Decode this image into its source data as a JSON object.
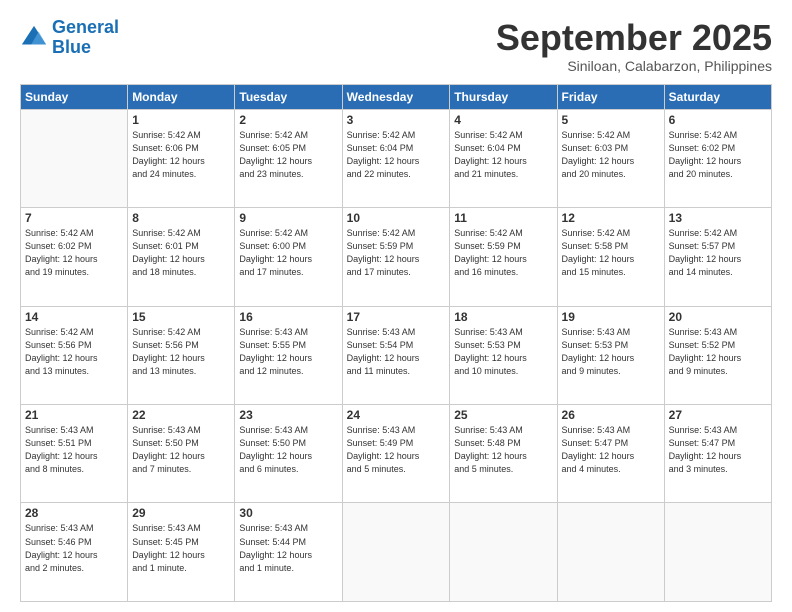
{
  "logo": {
    "text_general": "General",
    "text_blue": "Blue"
  },
  "header": {
    "month": "September 2025",
    "location": "Siniloan, Calabarzon, Philippines"
  },
  "weekdays": [
    "Sunday",
    "Monday",
    "Tuesday",
    "Wednesday",
    "Thursday",
    "Friday",
    "Saturday"
  ],
  "weeks": [
    [
      {
        "day": "",
        "info": ""
      },
      {
        "day": "1",
        "info": "Sunrise: 5:42 AM\nSunset: 6:06 PM\nDaylight: 12 hours\nand 24 minutes."
      },
      {
        "day": "2",
        "info": "Sunrise: 5:42 AM\nSunset: 6:05 PM\nDaylight: 12 hours\nand 23 minutes."
      },
      {
        "day": "3",
        "info": "Sunrise: 5:42 AM\nSunset: 6:04 PM\nDaylight: 12 hours\nand 22 minutes."
      },
      {
        "day": "4",
        "info": "Sunrise: 5:42 AM\nSunset: 6:04 PM\nDaylight: 12 hours\nand 21 minutes."
      },
      {
        "day": "5",
        "info": "Sunrise: 5:42 AM\nSunset: 6:03 PM\nDaylight: 12 hours\nand 20 minutes."
      },
      {
        "day": "6",
        "info": "Sunrise: 5:42 AM\nSunset: 6:02 PM\nDaylight: 12 hours\nand 20 minutes."
      }
    ],
    [
      {
        "day": "7",
        "info": "Sunrise: 5:42 AM\nSunset: 6:02 PM\nDaylight: 12 hours\nand 19 minutes."
      },
      {
        "day": "8",
        "info": "Sunrise: 5:42 AM\nSunset: 6:01 PM\nDaylight: 12 hours\nand 18 minutes."
      },
      {
        "day": "9",
        "info": "Sunrise: 5:42 AM\nSunset: 6:00 PM\nDaylight: 12 hours\nand 17 minutes."
      },
      {
        "day": "10",
        "info": "Sunrise: 5:42 AM\nSunset: 5:59 PM\nDaylight: 12 hours\nand 17 minutes."
      },
      {
        "day": "11",
        "info": "Sunrise: 5:42 AM\nSunset: 5:59 PM\nDaylight: 12 hours\nand 16 minutes."
      },
      {
        "day": "12",
        "info": "Sunrise: 5:42 AM\nSunset: 5:58 PM\nDaylight: 12 hours\nand 15 minutes."
      },
      {
        "day": "13",
        "info": "Sunrise: 5:42 AM\nSunset: 5:57 PM\nDaylight: 12 hours\nand 14 minutes."
      }
    ],
    [
      {
        "day": "14",
        "info": "Sunrise: 5:42 AM\nSunset: 5:56 PM\nDaylight: 12 hours\nand 13 minutes."
      },
      {
        "day": "15",
        "info": "Sunrise: 5:42 AM\nSunset: 5:56 PM\nDaylight: 12 hours\nand 13 minutes."
      },
      {
        "day": "16",
        "info": "Sunrise: 5:43 AM\nSunset: 5:55 PM\nDaylight: 12 hours\nand 12 minutes."
      },
      {
        "day": "17",
        "info": "Sunrise: 5:43 AM\nSunset: 5:54 PM\nDaylight: 12 hours\nand 11 minutes."
      },
      {
        "day": "18",
        "info": "Sunrise: 5:43 AM\nSunset: 5:53 PM\nDaylight: 12 hours\nand 10 minutes."
      },
      {
        "day": "19",
        "info": "Sunrise: 5:43 AM\nSunset: 5:53 PM\nDaylight: 12 hours\nand 9 minutes."
      },
      {
        "day": "20",
        "info": "Sunrise: 5:43 AM\nSunset: 5:52 PM\nDaylight: 12 hours\nand 9 minutes."
      }
    ],
    [
      {
        "day": "21",
        "info": "Sunrise: 5:43 AM\nSunset: 5:51 PM\nDaylight: 12 hours\nand 8 minutes."
      },
      {
        "day": "22",
        "info": "Sunrise: 5:43 AM\nSunset: 5:50 PM\nDaylight: 12 hours\nand 7 minutes."
      },
      {
        "day": "23",
        "info": "Sunrise: 5:43 AM\nSunset: 5:50 PM\nDaylight: 12 hours\nand 6 minutes."
      },
      {
        "day": "24",
        "info": "Sunrise: 5:43 AM\nSunset: 5:49 PM\nDaylight: 12 hours\nand 5 minutes."
      },
      {
        "day": "25",
        "info": "Sunrise: 5:43 AM\nSunset: 5:48 PM\nDaylight: 12 hours\nand 5 minutes."
      },
      {
        "day": "26",
        "info": "Sunrise: 5:43 AM\nSunset: 5:47 PM\nDaylight: 12 hours\nand 4 minutes."
      },
      {
        "day": "27",
        "info": "Sunrise: 5:43 AM\nSunset: 5:47 PM\nDaylight: 12 hours\nand 3 minutes."
      }
    ],
    [
      {
        "day": "28",
        "info": "Sunrise: 5:43 AM\nSunset: 5:46 PM\nDaylight: 12 hours\nand 2 minutes."
      },
      {
        "day": "29",
        "info": "Sunrise: 5:43 AM\nSunset: 5:45 PM\nDaylight: 12 hours\nand 1 minute."
      },
      {
        "day": "30",
        "info": "Sunrise: 5:43 AM\nSunset: 5:44 PM\nDaylight: 12 hours\nand 1 minute."
      },
      {
        "day": "",
        "info": ""
      },
      {
        "day": "",
        "info": ""
      },
      {
        "day": "",
        "info": ""
      },
      {
        "day": "",
        "info": ""
      }
    ]
  ]
}
